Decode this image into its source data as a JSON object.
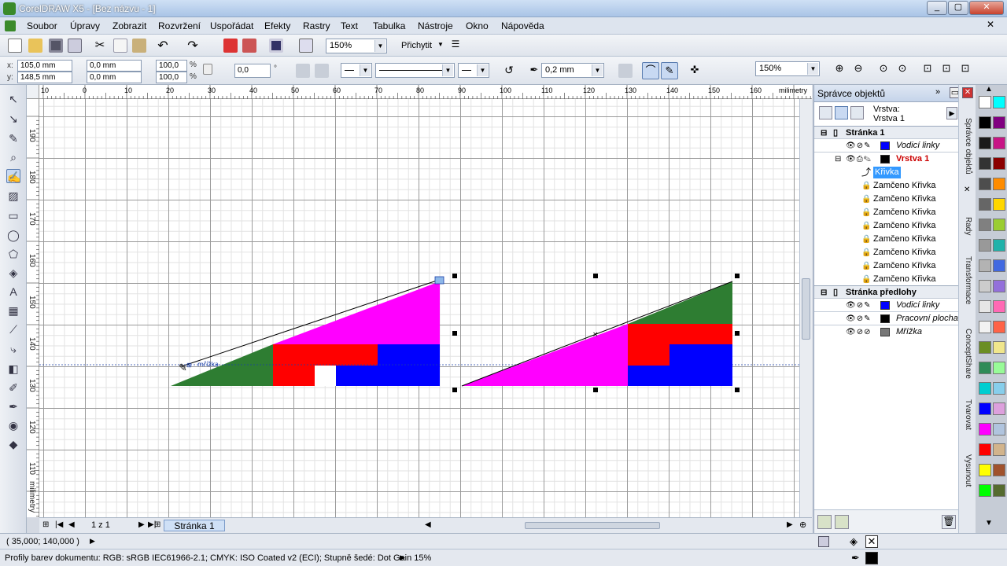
{
  "window": {
    "title": "CorelDRAW X5 - [Bez názvu - 1]"
  },
  "menu": [
    "Soubor",
    "Úpravy",
    "Zobrazit",
    "Rozvržení",
    "Uspořádat",
    "Efekty",
    "Rastry",
    "Text",
    "Tabulka",
    "Nástroje",
    "Okno",
    "Nápověda"
  ],
  "toolbar": {
    "zoom_value": "150%",
    "snap_label": "Přichytit"
  },
  "propbar": {
    "x_label": "x:",
    "x_value": "105,0 mm",
    "y_label": "y:",
    "y_value": "148,5 mm",
    "w_value": "0,0 mm",
    "h_value": "0,0 mm",
    "scale_w": "100,0",
    "scale_h": "100,0",
    "pct": "%",
    "angle_value": "0,0",
    "degree": "°",
    "outline_width": "0,2 mm",
    "zoom_value": "150%"
  },
  "rulers": {
    "h_ticks": [
      "10",
      "0",
      "10",
      "20",
      "30",
      "40",
      "50",
      "60",
      "70",
      "80",
      "90",
      "100",
      "110",
      "120",
      "130",
      "140",
      "150",
      "160"
    ],
    "units": "milimetry",
    "v_ticks": [
      "190",
      "180",
      "170",
      "160",
      "150",
      "140",
      "130",
      "120",
      "110"
    ],
    "v_units": "milimetry"
  },
  "canvas": {
    "snap_hint": "mřížka"
  },
  "pagebar": {
    "page_count": "1 z 1",
    "page_tab": "Stránka 1"
  },
  "docker": {
    "title": "Správce objektů",
    "layer_label": "Vrstva:",
    "layer_name": "Vrstva 1",
    "rows": [
      {
        "text": "Stránka 1",
        "kind": "page"
      },
      {
        "text": "Vodicí linky",
        "kind": "layer",
        "color": "#0000ff",
        "italic": true
      },
      {
        "text": "Vrstva 1",
        "kind": "layer",
        "color": "#000000",
        "active": true
      },
      {
        "text": "Křivka",
        "kind": "object",
        "selected": true
      },
      {
        "text": "Zamčeno Křivka",
        "kind": "locked"
      },
      {
        "text": "Zamčeno Křivka",
        "kind": "locked"
      },
      {
        "text": "Zamčeno Křivka",
        "kind": "locked"
      },
      {
        "text": "Zamčeno Křivka",
        "kind": "locked"
      },
      {
        "text": "Zamčeno Křivka",
        "kind": "locked"
      },
      {
        "text": "Zamčeno Křivka",
        "kind": "locked"
      },
      {
        "text": "Zamčeno Křivka",
        "kind": "locked"
      },
      {
        "text": "Zamčeno Křivka",
        "kind": "locked"
      },
      {
        "text": "Stránka předlohy",
        "kind": "page"
      },
      {
        "text": "Vodicí linky",
        "kind": "layer",
        "color": "#0000ff",
        "italic": true
      },
      {
        "text": "Pracovní plocha",
        "kind": "layer",
        "color": "#000000",
        "italic": true
      },
      {
        "text": "Mřížka",
        "kind": "layer",
        "color": "#777777",
        "italic": true
      }
    ]
  },
  "docker_tabs": [
    "Správce objektů",
    "Rady",
    "Transformace",
    "ConceptShare",
    "Tvarovat",
    "Vysunout"
  ],
  "palette": {
    "colors": [
      "#ffffff",
      "#000000",
      "#1a1a1a",
      "#333333",
      "#4d4d4d",
      "#666666",
      "#808080",
      "#999999",
      "#b3b3b3",
      "#cccccc",
      "#e6e6e6",
      "#f2f2f2",
      "#6b8e23",
      "#2e8b57",
      "#00ced1",
      "#0000ff",
      "#ff00ff",
      "#ff0000",
      "#ffff00",
      "#00ff00",
      "#00ffff",
      "#800080",
      "#c71585",
      "#8b0000",
      "#ff8c00",
      "#ffd700",
      "#9acd32",
      "#20b2aa",
      "#4169e1",
      "#9370db",
      "#ff69b4",
      "#ff6347",
      "#f0e68c",
      "#98fb98",
      "#87ceeb",
      "#dda0dd",
      "#b0c4de",
      "#d2b48c",
      "#a0522d",
      "#556b2f"
    ]
  },
  "status": {
    "coords": "( 35,000; 140,000 )",
    "profile": "Profily barev dokumentu: RGB: sRGB IEC61966-2.1; CMYK: ISO Coated v2 (ECI); Stupně šedé: Dot Gain 15%"
  },
  "shapes_colors": {
    "green": "#2e7d32",
    "magenta": "#ff00ff",
    "red": "#ff0000",
    "blue": "#0000ff"
  }
}
